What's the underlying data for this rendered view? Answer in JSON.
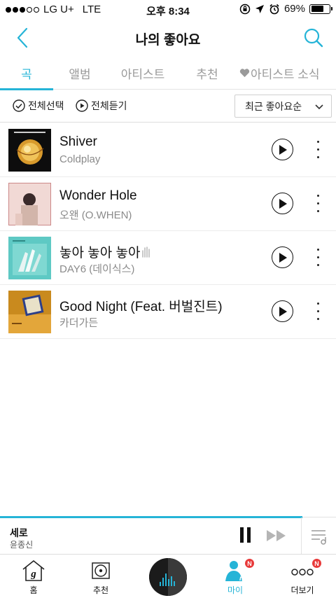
{
  "status_bar": {
    "carrier": "LG U+",
    "network": "LTE",
    "time": "오후 8:34",
    "battery": "69%",
    "battery_level": 0.69
  },
  "header": {
    "title": "나의 좋아요"
  },
  "tabs": [
    {
      "label": "곡",
      "active": true
    },
    {
      "label": "앨범",
      "active": false
    },
    {
      "label": "아티스트",
      "active": false
    },
    {
      "label": "추천",
      "active": false
    },
    {
      "label": "아티스트 소식",
      "active": false
    }
  ],
  "toolbar": {
    "select_all": "전체선택",
    "play_all": "전체듣기",
    "sort": "최근 좋아요순"
  },
  "songs": [
    {
      "title": "Shiver",
      "artist": "Coldplay"
    },
    {
      "title": "Wonder Hole",
      "artist": "오왠 (O.WHEN)"
    },
    {
      "title": "놓아 놓아 놓아",
      "artist": "DAY6 (데이식스)"
    },
    {
      "title": "Good Night (Feat. 버벌진트)",
      "artist": "카더가든"
    }
  ],
  "now_playing": {
    "title": "세로",
    "artist": "윤종신",
    "progress": 0.9
  },
  "bottom_nav": [
    {
      "label": "홈"
    },
    {
      "label": "추천"
    },
    {
      "label": ""
    },
    {
      "label": "마이",
      "badge": "N"
    },
    {
      "label": "더보기",
      "badge": "N"
    }
  ],
  "colors": {
    "accent": "#25b4d7",
    "badge": "#e83a3a"
  }
}
